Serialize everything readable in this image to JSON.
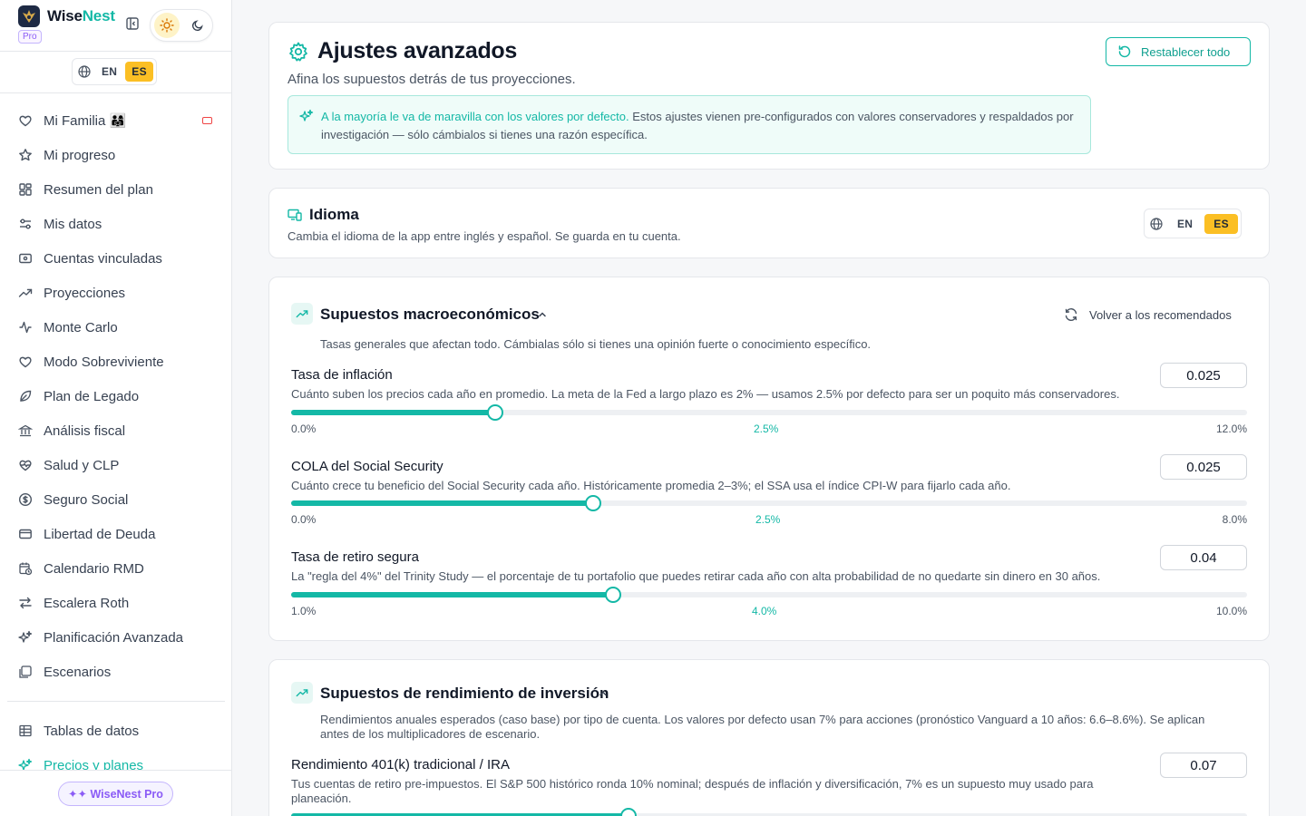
{
  "sidebar": {
    "brand_main": "Wise",
    "brand_accent": "Nest",
    "pro_tag": "Pro",
    "lang": {
      "en": "EN",
      "es": "ES"
    },
    "nav": [
      {
        "label": "Mi Familia 👨‍👩‍👧",
        "icon": "heart-icon"
      },
      {
        "label": "Mi progreso",
        "icon": "star-icon"
      },
      {
        "label": "Resumen del plan",
        "icon": "grid-icon"
      },
      {
        "label": "Mis datos",
        "icon": "sliders-icon"
      },
      {
        "label": "Cuentas vinculadas",
        "icon": "wallet-icon"
      },
      {
        "label": "Proyecciones",
        "icon": "trending-up-icon"
      },
      {
        "label": "Monte Carlo",
        "icon": "activity-icon"
      },
      {
        "label": "Modo Sobreviviente",
        "icon": "heart-icon"
      },
      {
        "label": "Plan de Legado",
        "icon": "leaf-icon"
      },
      {
        "label": "Análisis fiscal",
        "icon": "bank-icon"
      },
      {
        "label": "Salud y CLP",
        "icon": "heart-pulse-icon"
      },
      {
        "label": "Seguro Social",
        "icon": "dollar-circle-icon"
      },
      {
        "label": "Libertad de Deuda",
        "icon": "credit-card-icon"
      },
      {
        "label": "Calendario RMD",
        "icon": "calendar-clock-icon"
      },
      {
        "label": "Escalera Roth",
        "icon": "arrows-swap-icon"
      },
      {
        "label": "Planificación Avanzada",
        "icon": "sparkles-icon"
      },
      {
        "label": "Escenarios",
        "icon": "layers-icon"
      }
    ],
    "nav_secondary": [
      {
        "label": "Tablas de datos",
        "icon": "table-icon"
      },
      {
        "label": "Precios y planes",
        "icon": "sparkles-icon"
      }
    ],
    "pro_button": "✦✦ WiseNest Pro"
  },
  "header": {
    "title": "Ajustes avanzados",
    "subtitle": "Afina los supuestos detrás de tus proyecciones.",
    "reset_all": "Restablecer todo",
    "hint_lead": "A la mayoría le va de maravilla con los valores por defecto.",
    "hint_body": " Estos ajustes vienen pre-configurados con valores conservadores y respaldados por investigación — sólo cámbialos si tienes una razón específica."
  },
  "language_card": {
    "title": "Idioma",
    "description": "Cambia el idioma de la app entre inglés y español. Se guarda en tu cuenta.",
    "en": "EN",
    "es": "ES"
  },
  "macro": {
    "title": "Supuestos macroeconómicos",
    "reset": "Volver a los recomendados",
    "description": "Tasas generales que afectan todo. Cámbialas sólo si tienes una opinión fuerte o conocimiento específico.",
    "params": [
      {
        "title": "Tasa de inflación",
        "description": "Cuánto suben los precios cada año en promedio. La meta de la Fed a largo plazo es 2% — usamos 2.5% por defecto para ser un poquito más conservadores.",
        "value": "0.025",
        "min_label": "0.0%",
        "mid_label": "2.5%",
        "max_label": "12.0%",
        "fill_fraction": 0.213
      },
      {
        "title": "COLA del Social Security",
        "description": "Cuánto crece tu beneficio del Social Security cada año. Históricamente promedia 2–3%; el SSA usa el índice CPI-W para fijarlo cada año.",
        "value": "0.025",
        "min_label": "0.0%",
        "mid_label": "2.5%",
        "max_label": "8.0%",
        "fill_fraction": 0.316
      },
      {
        "title": "Tasa de retiro segura",
        "description": "La \"regla del 4%\" del Trinity Study — el porcentaje de tu portafolio que puedes retirar cada año con alta probabilidad de no quedarte sin dinero en 30 años.",
        "value": "0.04",
        "min_label": "1.0%",
        "mid_label": "4.0%",
        "max_label": "10.0%",
        "fill_fraction": 0.337
      }
    ]
  },
  "investment": {
    "title": "Supuestos de rendimiento de inversión",
    "description": "Rendimientos anuales esperados (caso base) por tipo de cuenta. Los valores por defecto usan 7% para acciones (pronóstico Vanguard a 10 años: 6.6–8.6%). Se aplican antes de los multiplicadores de escenario.",
    "params": [
      {
        "title": "Rendimiento 401(k) tradicional / IRA",
        "description": "Tus cuentas de retiro pre-impuestos. El S&P 500 histórico ronda 10% nominal; después de inflación y diversificación, 7% es un supuesto muy usado para planeación.",
        "value": "0.07",
        "fill_fraction": 0.353
      }
    ]
  }
}
